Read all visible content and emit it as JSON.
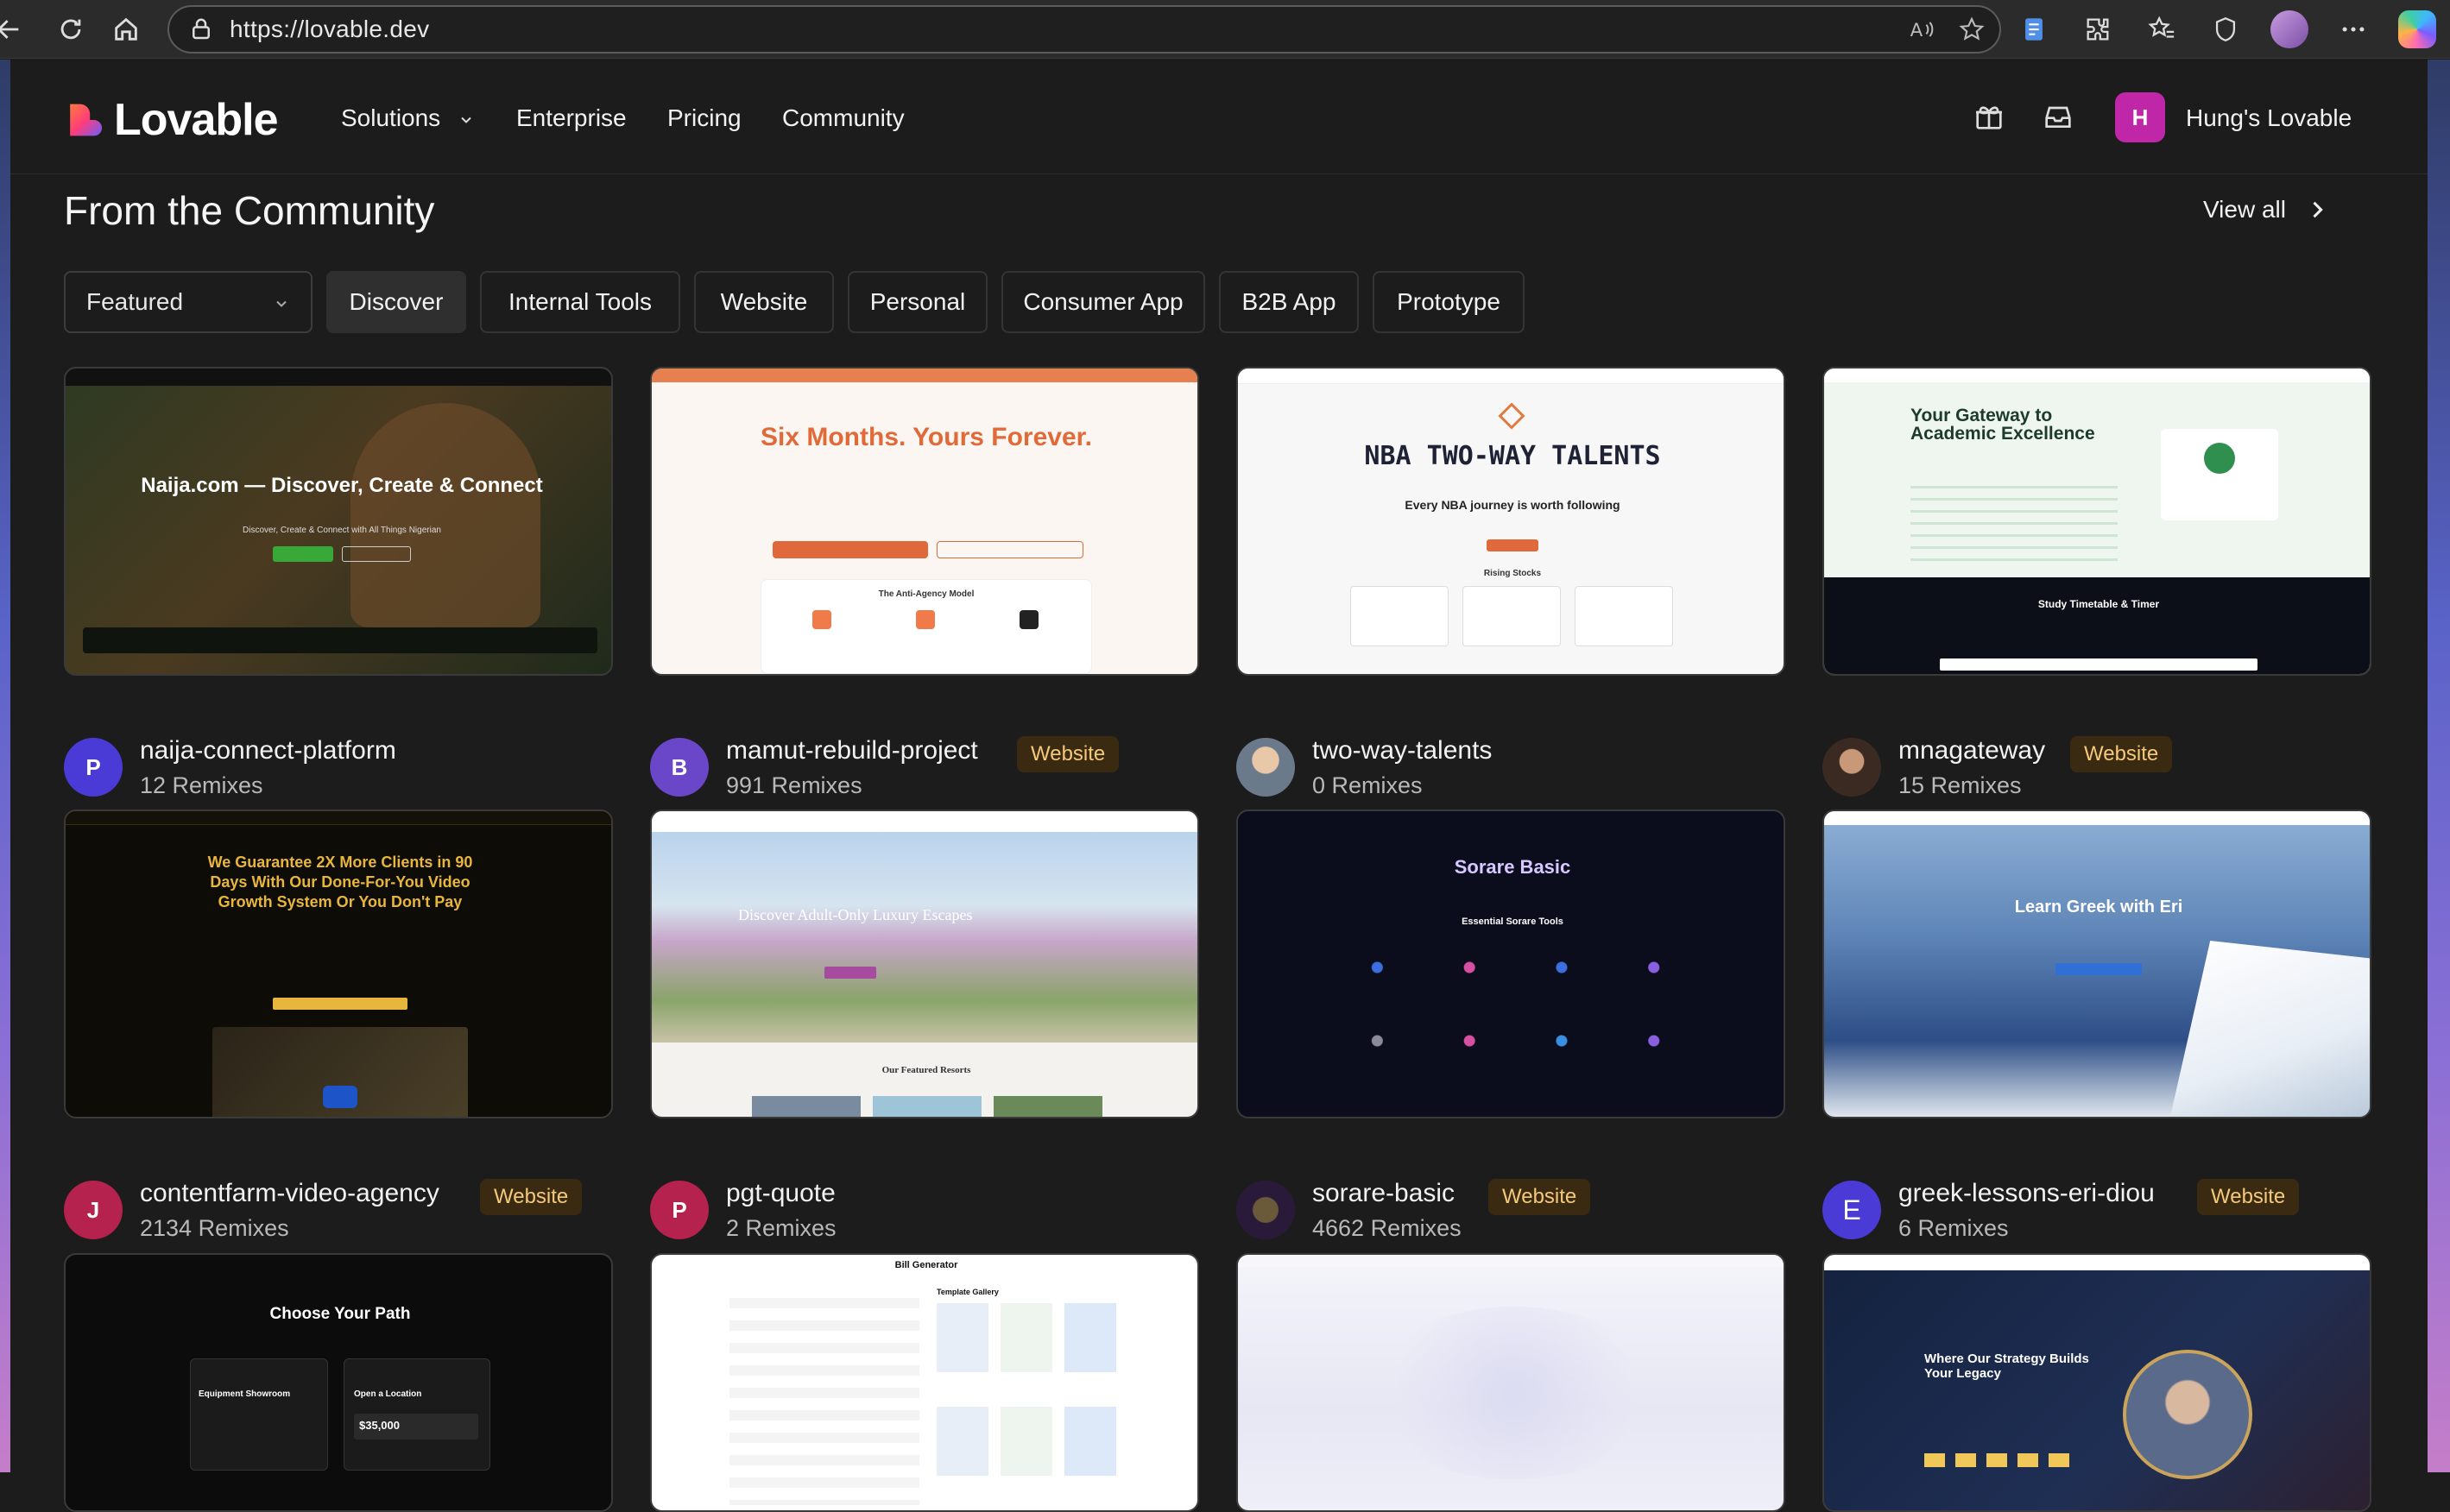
{
  "browser": {
    "url": "https://lovable.dev"
  },
  "site": {
    "logo_text": "Lovable",
    "nav": [
      "Solutions",
      "Enterprise",
      "Pricing",
      "Community"
    ],
    "user_initial": "H",
    "user_name": "Hung's Lovable"
  },
  "section": {
    "title": "From the Community",
    "view_all": "View all",
    "sort_value": "Featured",
    "filters": [
      "Discover",
      "Internal Tools",
      "Website",
      "Personal",
      "Consumer App",
      "B2B App",
      "Prototype"
    ],
    "active_filter": "Discover"
  },
  "projects": [
    {
      "name": "naija-connect-platform",
      "remixes": "12 Remixes",
      "avatar": "P",
      "avatar_color": "#4b3bd6",
      "badge": ""
    },
    {
      "name": "mamut-rebuild-project",
      "remixes": "991 Remixes",
      "avatar": "B",
      "avatar_color": "#6a46c8",
      "badge": "Website"
    },
    {
      "name": "two-way-talents",
      "remixes": "0 Remixes",
      "avatar": "",
      "avatar_color": "#8a8a8a",
      "badge": ""
    },
    {
      "name": "mnagateway",
      "remixes": "15 Remixes",
      "avatar": "",
      "avatar_color": "#5a3b2e",
      "badge": "Website"
    },
    {
      "name": "contentfarm-video-agency",
      "remixes": "2134 Remixes",
      "avatar": "J",
      "avatar_color": "#b5224d",
      "badge": "Website"
    },
    {
      "name": "pgt-quote",
      "remixes": "2 Remixes",
      "avatar": "P",
      "avatar_color": "#b5224d",
      "badge": ""
    },
    {
      "name": "sorare-basic",
      "remixes": "4662 Remixes",
      "avatar": "",
      "avatar_color": "#3a2a4a",
      "badge": "Website"
    },
    {
      "name": "greek-lessons-eri-diou",
      "remixes": "6 Remixes",
      "avatar": "E",
      "avatar_color": "#4b3bd6",
      "badge": "Website"
    }
  ],
  "thumbs": {
    "t1_title": "Naija.com — Discover, Create & Connect",
    "t1_sub": "Discover, Create & Connect with All Things Nigerian",
    "t2_title": "Six Months. Yours Forever.",
    "t2_section": "The Anti-Agency Model",
    "t3_title": "NBA TWO-WAY TALENTS",
    "t3_sub": "Every NBA journey is worth following",
    "t3_section": "Rising Stocks",
    "t4_title": "Your Gateway to Academic Excellence",
    "t4_section": "Study Timetable & Timer",
    "t5_title": "We Guarantee 2X More Clients in 90 Days With Our Done-For-You Video Growth System Or You Don't Pay",
    "t6_title": "Discover Adult-Only Luxury Escapes",
    "t6_section": "Our Featured Resorts",
    "t7_title": "Sorare Basic",
    "t7_section": "Essential Sorare Tools",
    "t8_title": "Learn Greek with Eri",
    "t9_title": "Choose Your Path",
    "t9_a": "Equipment Showroom",
    "t9_b": "Open a Location",
    "t9_price": "$35,000",
    "t10_title": "Bill Generator",
    "t10_section": "Template Gallery",
    "t12_title": "Where Our Strategy Builds Your Legacy"
  }
}
